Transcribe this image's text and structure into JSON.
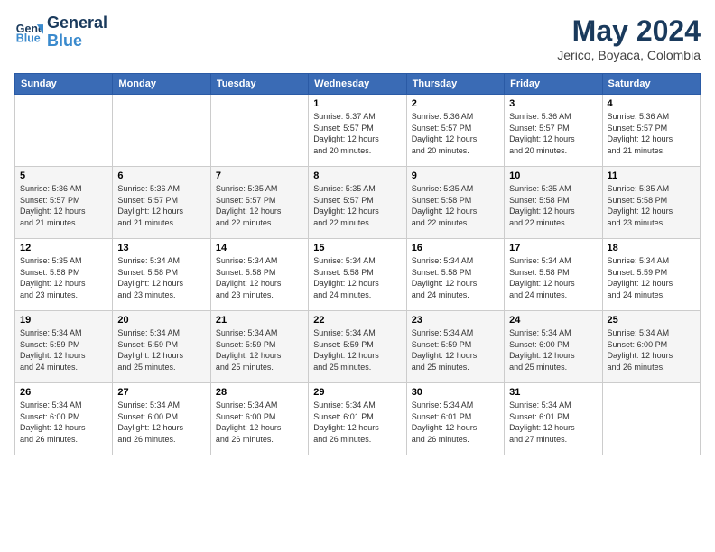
{
  "header": {
    "logo_line1": "General",
    "logo_line2": "Blue",
    "month_year": "May 2024",
    "location": "Jerico, Boyaca, Colombia"
  },
  "weekdays": [
    "Sunday",
    "Monday",
    "Tuesday",
    "Wednesday",
    "Thursday",
    "Friday",
    "Saturday"
  ],
  "weeks": [
    [
      {
        "day": "",
        "info": ""
      },
      {
        "day": "",
        "info": ""
      },
      {
        "day": "",
        "info": ""
      },
      {
        "day": "1",
        "info": "Sunrise: 5:37 AM\nSunset: 5:57 PM\nDaylight: 12 hours\nand 20 minutes."
      },
      {
        "day": "2",
        "info": "Sunrise: 5:36 AM\nSunset: 5:57 PM\nDaylight: 12 hours\nand 20 minutes."
      },
      {
        "day": "3",
        "info": "Sunrise: 5:36 AM\nSunset: 5:57 PM\nDaylight: 12 hours\nand 20 minutes."
      },
      {
        "day": "4",
        "info": "Sunrise: 5:36 AM\nSunset: 5:57 PM\nDaylight: 12 hours\nand 21 minutes."
      }
    ],
    [
      {
        "day": "5",
        "info": "Sunrise: 5:36 AM\nSunset: 5:57 PM\nDaylight: 12 hours\nand 21 minutes."
      },
      {
        "day": "6",
        "info": "Sunrise: 5:36 AM\nSunset: 5:57 PM\nDaylight: 12 hours\nand 21 minutes."
      },
      {
        "day": "7",
        "info": "Sunrise: 5:35 AM\nSunset: 5:57 PM\nDaylight: 12 hours\nand 22 minutes."
      },
      {
        "day": "8",
        "info": "Sunrise: 5:35 AM\nSunset: 5:57 PM\nDaylight: 12 hours\nand 22 minutes."
      },
      {
        "day": "9",
        "info": "Sunrise: 5:35 AM\nSunset: 5:58 PM\nDaylight: 12 hours\nand 22 minutes."
      },
      {
        "day": "10",
        "info": "Sunrise: 5:35 AM\nSunset: 5:58 PM\nDaylight: 12 hours\nand 22 minutes."
      },
      {
        "day": "11",
        "info": "Sunrise: 5:35 AM\nSunset: 5:58 PM\nDaylight: 12 hours\nand 23 minutes."
      }
    ],
    [
      {
        "day": "12",
        "info": "Sunrise: 5:35 AM\nSunset: 5:58 PM\nDaylight: 12 hours\nand 23 minutes."
      },
      {
        "day": "13",
        "info": "Sunrise: 5:34 AM\nSunset: 5:58 PM\nDaylight: 12 hours\nand 23 minutes."
      },
      {
        "day": "14",
        "info": "Sunrise: 5:34 AM\nSunset: 5:58 PM\nDaylight: 12 hours\nand 23 minutes."
      },
      {
        "day": "15",
        "info": "Sunrise: 5:34 AM\nSunset: 5:58 PM\nDaylight: 12 hours\nand 24 minutes."
      },
      {
        "day": "16",
        "info": "Sunrise: 5:34 AM\nSunset: 5:58 PM\nDaylight: 12 hours\nand 24 minutes."
      },
      {
        "day": "17",
        "info": "Sunrise: 5:34 AM\nSunset: 5:58 PM\nDaylight: 12 hours\nand 24 minutes."
      },
      {
        "day": "18",
        "info": "Sunrise: 5:34 AM\nSunset: 5:59 PM\nDaylight: 12 hours\nand 24 minutes."
      }
    ],
    [
      {
        "day": "19",
        "info": "Sunrise: 5:34 AM\nSunset: 5:59 PM\nDaylight: 12 hours\nand 24 minutes."
      },
      {
        "day": "20",
        "info": "Sunrise: 5:34 AM\nSunset: 5:59 PM\nDaylight: 12 hours\nand 25 minutes."
      },
      {
        "day": "21",
        "info": "Sunrise: 5:34 AM\nSunset: 5:59 PM\nDaylight: 12 hours\nand 25 minutes."
      },
      {
        "day": "22",
        "info": "Sunrise: 5:34 AM\nSunset: 5:59 PM\nDaylight: 12 hours\nand 25 minutes."
      },
      {
        "day": "23",
        "info": "Sunrise: 5:34 AM\nSunset: 5:59 PM\nDaylight: 12 hours\nand 25 minutes."
      },
      {
        "day": "24",
        "info": "Sunrise: 5:34 AM\nSunset: 6:00 PM\nDaylight: 12 hours\nand 25 minutes."
      },
      {
        "day": "25",
        "info": "Sunrise: 5:34 AM\nSunset: 6:00 PM\nDaylight: 12 hours\nand 26 minutes."
      }
    ],
    [
      {
        "day": "26",
        "info": "Sunrise: 5:34 AM\nSunset: 6:00 PM\nDaylight: 12 hours\nand 26 minutes."
      },
      {
        "day": "27",
        "info": "Sunrise: 5:34 AM\nSunset: 6:00 PM\nDaylight: 12 hours\nand 26 minutes."
      },
      {
        "day": "28",
        "info": "Sunrise: 5:34 AM\nSunset: 6:00 PM\nDaylight: 12 hours\nand 26 minutes."
      },
      {
        "day": "29",
        "info": "Sunrise: 5:34 AM\nSunset: 6:01 PM\nDaylight: 12 hours\nand 26 minutes."
      },
      {
        "day": "30",
        "info": "Sunrise: 5:34 AM\nSunset: 6:01 PM\nDaylight: 12 hours\nand 26 minutes."
      },
      {
        "day": "31",
        "info": "Sunrise: 5:34 AM\nSunset: 6:01 PM\nDaylight: 12 hours\nand 27 minutes."
      },
      {
        "day": "",
        "info": ""
      }
    ]
  ]
}
